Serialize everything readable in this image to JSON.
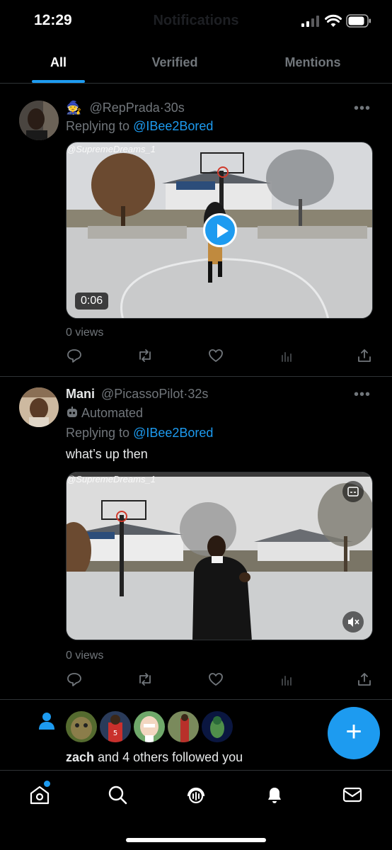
{
  "status_bar": {
    "time": "12:29",
    "ghost_title": "Notifications"
  },
  "tabs": [
    {
      "label": "All",
      "active": true
    },
    {
      "label": "Verified",
      "active": false
    },
    {
      "label": "Mentions",
      "active": false
    }
  ],
  "posts": [
    {
      "display_name": "",
      "handle": "@RepPrada",
      "time": "30s",
      "replying_prefix": "Replying to",
      "replying_to": "@IBee2Bored",
      "text": "",
      "media": {
        "watermark": "@SupremeDreams_1",
        "duration": "0:06",
        "playing": false
      },
      "views": "0 views"
    },
    {
      "display_name": "Mani",
      "handle": "@PicassoPilot",
      "time": "32s",
      "automated_label": "Automated",
      "replying_prefix": "Replying to",
      "replying_to": "@IBee2Bored",
      "text": "what’s up then",
      "media": {
        "watermark": "@SupremeDreams_1",
        "muted": true
      },
      "views": "0 views"
    }
  ],
  "follow_notification": {
    "name": "zach",
    "rest": " and 4 others followed you",
    "avatar_count": 5
  },
  "fab": {
    "label": "+"
  },
  "bottom_nav": [
    "home-icon",
    "search-icon",
    "spaces-icon",
    "notifications-icon",
    "messages-icon"
  ],
  "colors": {
    "accent": "#1d9bf0",
    "secondary_text": "#71767b",
    "divider": "#2f3336"
  }
}
